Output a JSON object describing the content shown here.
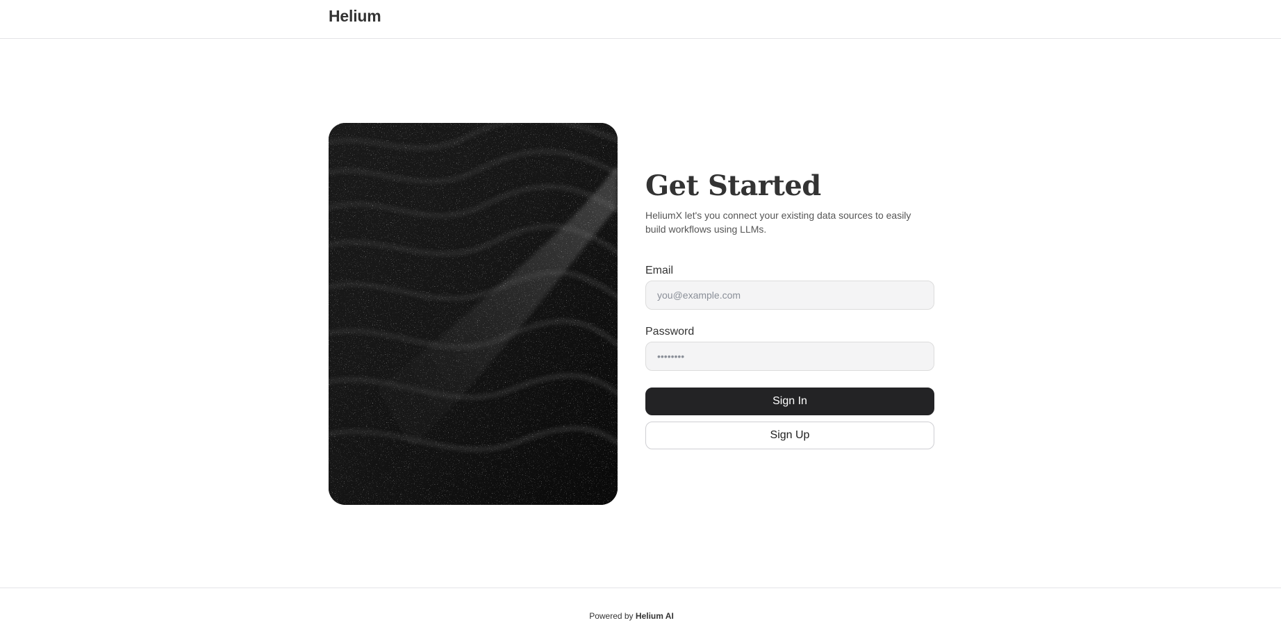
{
  "header": {
    "brand": "Helium"
  },
  "hero": {
    "image_description": "dark sand dunes texture"
  },
  "form": {
    "title": "Get Started",
    "subtitle": "HeliumX let's you connect your existing data sources to easily build workflows using LLMs.",
    "email_label": "Email",
    "email_placeholder": "you@example.com",
    "password_label": "Password",
    "password_placeholder": "••••••••",
    "sign_in_label": "Sign In",
    "sign_up_label": "Sign Up"
  },
  "footer": {
    "powered_prefix": "Powered by",
    "powered_brand": "Helium AI"
  },
  "colors": {
    "primary_button": "#232325",
    "input_background": "#f4f4f5",
    "border": "#e4e4e7"
  }
}
